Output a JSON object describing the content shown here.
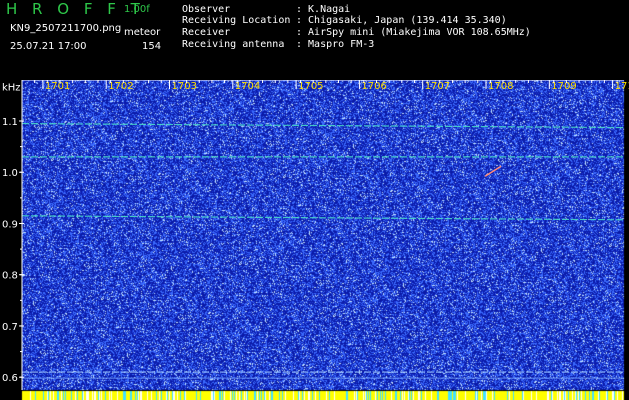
{
  "header": {
    "app_title": "H R O F F T",
    "version": "1.00f",
    "filename": "KN9_2507211700.png",
    "mode": "meteor",
    "datetime": "25.07.21 17:00",
    "count": "154",
    "info": [
      {
        "label": "Observer",
        "value": ": K.Nagai"
      },
      {
        "label": "Receiving Location",
        "value": ": Chigasaki, Japan (139.414 35.340)"
      },
      {
        "label": "Receiver",
        "value": ": AirSpy mini (Miakejima VOR 108.65MHz)"
      },
      {
        "label": "Receiving antenna",
        "value": ": Maspro FM-3"
      }
    ]
  },
  "chart_data": {
    "type": "heatmap",
    "y_unit": "kHz",
    "y_ticks": [
      "1.1",
      "1.0",
      "0.9",
      "0.8",
      "0.7",
      "0.6"
    ],
    "y_values": [
      1.1,
      1.0,
      0.9,
      0.8,
      0.7,
      0.6
    ],
    "ylim": [
      0.575,
      1.18
    ],
    "x_ticks": [
      "1701",
      "1702",
      "1703",
      "1704",
      "1705",
      "1706",
      "1707",
      "1708",
      "1709",
      "1710"
    ],
    "x_values": [
      1701,
      1702,
      1703,
      1704,
      1705,
      1706,
      1707,
      1708,
      1709,
      1710
    ],
    "xlim": [
      1700.67,
      1710.18
    ],
    "carrier_lines_khz": [
      1.095,
      1.03,
      0.915,
      0.61
    ],
    "meteor_echo": {
      "x": 1708.08,
      "y": 1.0
    },
    "colors": {
      "background": "#0a1aa8",
      "noise": "#3c6cff",
      "speckle": "#c8e8ff",
      "carrier": "#49d8c8",
      "axis": "#ffffff",
      "tick_label": "#ffe000",
      "footer": "#ffff00"
    }
  }
}
